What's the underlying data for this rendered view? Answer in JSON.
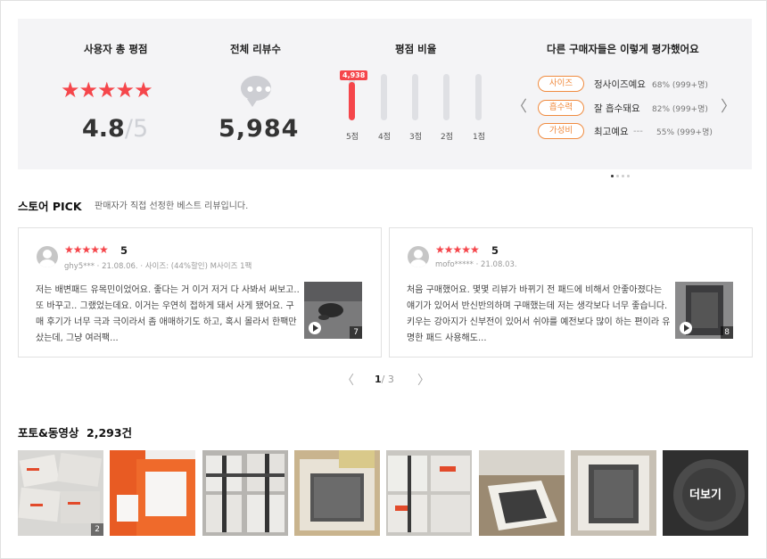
{
  "summary": {
    "rating_title": "사용자 총 평점",
    "rating_value": "4.8",
    "rating_max": "5",
    "reviews_title": "전체 리뷰수",
    "reviews_count": "5,984",
    "ratio_title": "평점 비율",
    "bars": [
      {
        "label": "5점",
        "fraction": 0.82,
        "badge": "4,938"
      },
      {
        "label": "4점",
        "fraction": 0
      },
      {
        "label": "3점",
        "fraction": 0
      },
      {
        "label": "2점",
        "fraction": 0
      },
      {
        "label": "1점",
        "fraction": 0
      }
    ],
    "keywords_title": "다른 구매자들은 이렇게 평가했어요",
    "keywords": [
      {
        "tag": "사이즈",
        "value": "정사이즈예요",
        "pct": "68% (999+명)"
      },
      {
        "tag": "흡수력",
        "value": "잘 흡수돼요",
        "pct": "82% (999+명)"
      },
      {
        "tag": "가성비",
        "value": "최고예요",
        "dash": "---",
        "pct": "55% (999+명)"
      }
    ]
  },
  "pick": {
    "title": "스토어 PICK",
    "desc": "판매자가 직접 선정한 베스트 리뷰입니다.",
    "cards": [
      {
        "stars": "★★★★★",
        "score": "5",
        "meta": "ghy5*** · 21.08.06. · 사이즈: (44%할인) M사이즈 1팩",
        "body": "저는 배변패드 유목민이었어요. 좋다는 거 이거 저거 다 사봐서 써보고.. 또 바꾸고.. 그랬었는데요. 이거는 우연히 접하게 돼서 사게 됐어요. 구매 후기가 너무 극과 극이라서 좀 애매하기도 하고, 혹시 몰라서 한팩만 샀는데, 그냥 여러팩...",
        "photo_count": "7"
      },
      {
        "stars": "★★★★★",
        "score": "5",
        "meta": "mofo***** · 21.08.03.",
        "body": "처음 구매했어요. 몇몇 리뷰가 바뀌기 전 패드에 비해서 안좋아졌다는 얘기가 있어서 반신반의하며 구매했는데 저는 생각보다 너무 좋습니다. 키우는 강아지가 신부전이 있어서 쉬야를 예전보다 많이 하는 편이라 유명한 패드 사용해도...",
        "photo_count": "8"
      }
    ],
    "page_current": "1",
    "page_total": "/ 3"
  },
  "photos": {
    "title": "포토&동영상",
    "count": "2,293건",
    "first_count": "2",
    "more_label": "더보기"
  },
  "colors": {
    "accent": "#f5464b",
    "tag": "#f08b3f"
  }
}
